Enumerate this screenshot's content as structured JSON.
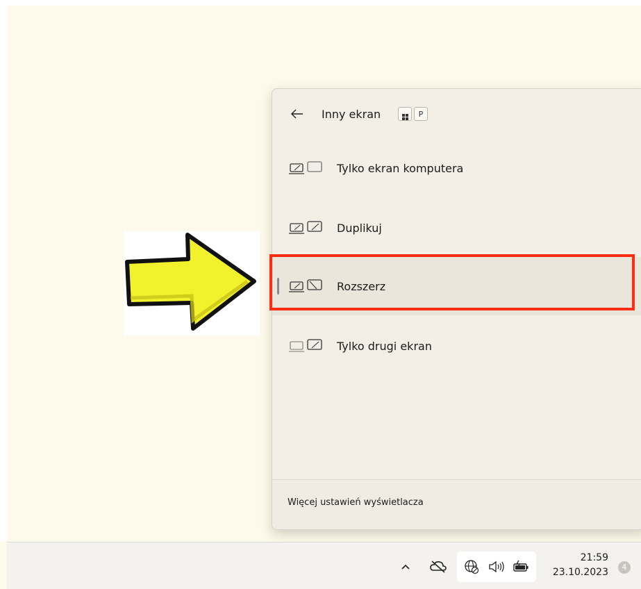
{
  "flyout": {
    "title": "Inny ekran",
    "shortcut": {
      "key2": "P"
    },
    "options": [
      {
        "label": "Tylko ekran komputera",
        "icon": "pc-screen-only-icon",
        "selected": false
      },
      {
        "label": "Duplikuj",
        "icon": "duplicate-icon",
        "selected": false
      },
      {
        "label": "Rozszerz",
        "icon": "extend-icon",
        "selected": true
      },
      {
        "label": "Tylko drugi ekran",
        "icon": "second-screen-only-icon",
        "selected": false
      }
    ],
    "footer_link": "Więcej ustawień wyświetlacza"
  },
  "annotation": {
    "highlight_color": "#ff2d14",
    "arrow_color": "#f2f22c"
  },
  "taskbar": {
    "time": "21:59",
    "date": "23.10.2023",
    "notification_count": "4"
  }
}
